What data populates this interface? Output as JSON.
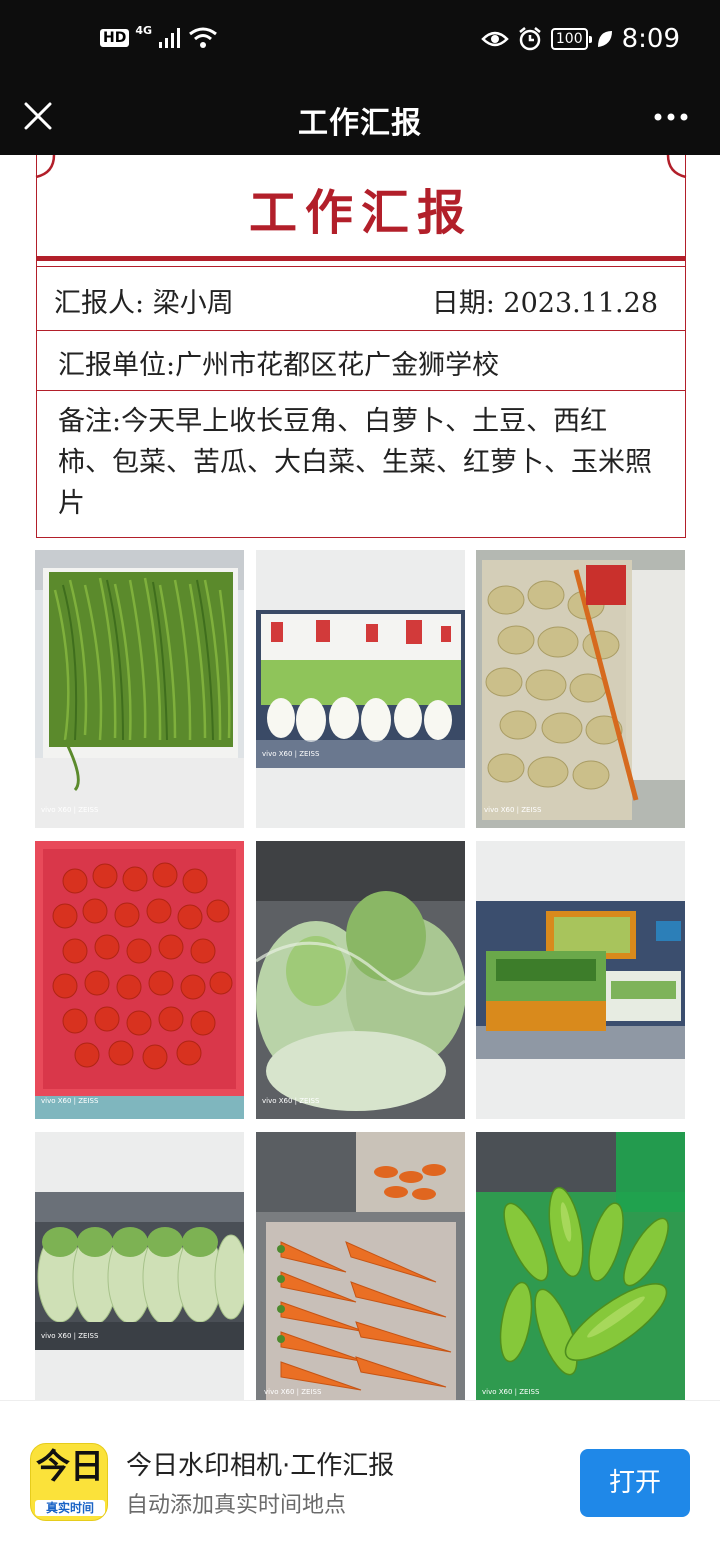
{
  "status_bar": {
    "hd": "HD",
    "network": "4G",
    "battery": "100",
    "time": "8:09"
  },
  "header": {
    "title": "工作汇报"
  },
  "report": {
    "heading": "工作汇报",
    "reporter_label": "汇报人:",
    "reporter_name": "梁小周",
    "date_label": "日期:",
    "date_value": "2023.11.28",
    "unit_label": "汇报单位:",
    "unit_value": "广州市花都区花广金狮学校",
    "note_label": "备注:",
    "note_value": "今天早上收长豆角、白萝卜、土豆、西红柿、包菜、苦瓜、大白菜、生菜、红萝卜、玉米照片"
  },
  "photos": [
    {
      "name": "green-beans",
      "caption": "vivo X60 | ZEISS"
    },
    {
      "name": "white-radish",
      "caption": "vivo X60 | ZEISS"
    },
    {
      "name": "potatoes",
      "caption": "vivo X60 | ZEISS"
    },
    {
      "name": "tomatoes",
      "caption": "vivo X60 | ZEISS"
    },
    {
      "name": "cabbage",
      "caption": "vivo X60 | ZEISS"
    },
    {
      "name": "lettuce-bundles",
      "caption": ""
    },
    {
      "name": "napa-cabbage",
      "caption": "vivo X60 | ZEISS"
    },
    {
      "name": "carrots",
      "caption": "vivo X60 | ZEISS"
    },
    {
      "name": "bitter-melon",
      "caption": "vivo X60 | ZEISS"
    }
  ],
  "banner": {
    "logo_text": "今日",
    "logo_caption": "真实时间",
    "app_name": "今日水印相机·工作汇报",
    "app_sub": "自动添加真实时间地点",
    "open_label": "打开"
  },
  "colors": {
    "accent_red": "#b21f2a",
    "button_blue": "#1f88e8",
    "logo_yellow": "#fbe23a"
  }
}
